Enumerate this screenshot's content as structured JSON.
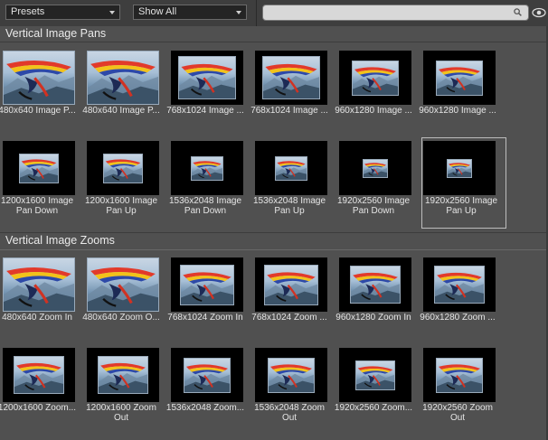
{
  "toolbar": {
    "presets": "Presets",
    "show_all": "Show All",
    "search_placeholder": ""
  },
  "sections": [
    {
      "title": "Vertical Image Pans",
      "items": [
        {
          "label": "480x640 Image P...",
          "scale": 1.0
        },
        {
          "label": "480x640 Image P...",
          "scale": 1.0
        },
        {
          "label": "768x1024 Image ...",
          "scale": 0.8
        },
        {
          "label": "768x1024 Image ...",
          "scale": 0.8
        },
        {
          "label": "960x1280 Image ...",
          "scale": 0.65
        },
        {
          "label": "960x1280 Image ...",
          "scale": 0.65
        },
        {
          "label": "1200x1600 Image Pan Down",
          "scale": 0.55
        },
        {
          "label": "1200x1600 Image Pan Up",
          "scale": 0.55
        },
        {
          "label": "1536x2048 Image Pan Down",
          "scale": 0.45
        },
        {
          "label": "1536x2048 Image Pan Up",
          "scale": 0.45
        },
        {
          "label": "1920x2560 Image Pan Down",
          "scale": 0.35
        },
        {
          "label": "1920x2560 Image Pan Up",
          "scale": 0.35,
          "selected": true
        }
      ]
    },
    {
      "title": "Vertical Image Zooms",
      "items": [
        {
          "label": "480x640 Zoom In",
          "scale": 1.0
        },
        {
          "label": "480x640 Zoom O...",
          "scale": 1.0
        },
        {
          "label": "768x1024 Zoom In",
          "scale": 0.75
        },
        {
          "label": "768x1024 Zoom ...",
          "scale": 0.75
        },
        {
          "label": "960x1280 Zoom In",
          "scale": 0.7
        },
        {
          "label": "960x1280 Zoom ...",
          "scale": 0.7
        },
        {
          "label": "1200x1600 Zoom...",
          "scale": 0.7
        },
        {
          "label": "1200x1600 Zoom Out",
          "scale": 0.7
        },
        {
          "label": "1536x2048 Zoom...",
          "scale": 0.65
        },
        {
          "label": "1536x2048 Zoom Out",
          "scale": 0.65
        },
        {
          "label": "1920x2560 Zoom...",
          "scale": 0.55
        },
        {
          "label": "1920x2560 Zoom Out",
          "scale": 0.65
        }
      ]
    }
  ]
}
